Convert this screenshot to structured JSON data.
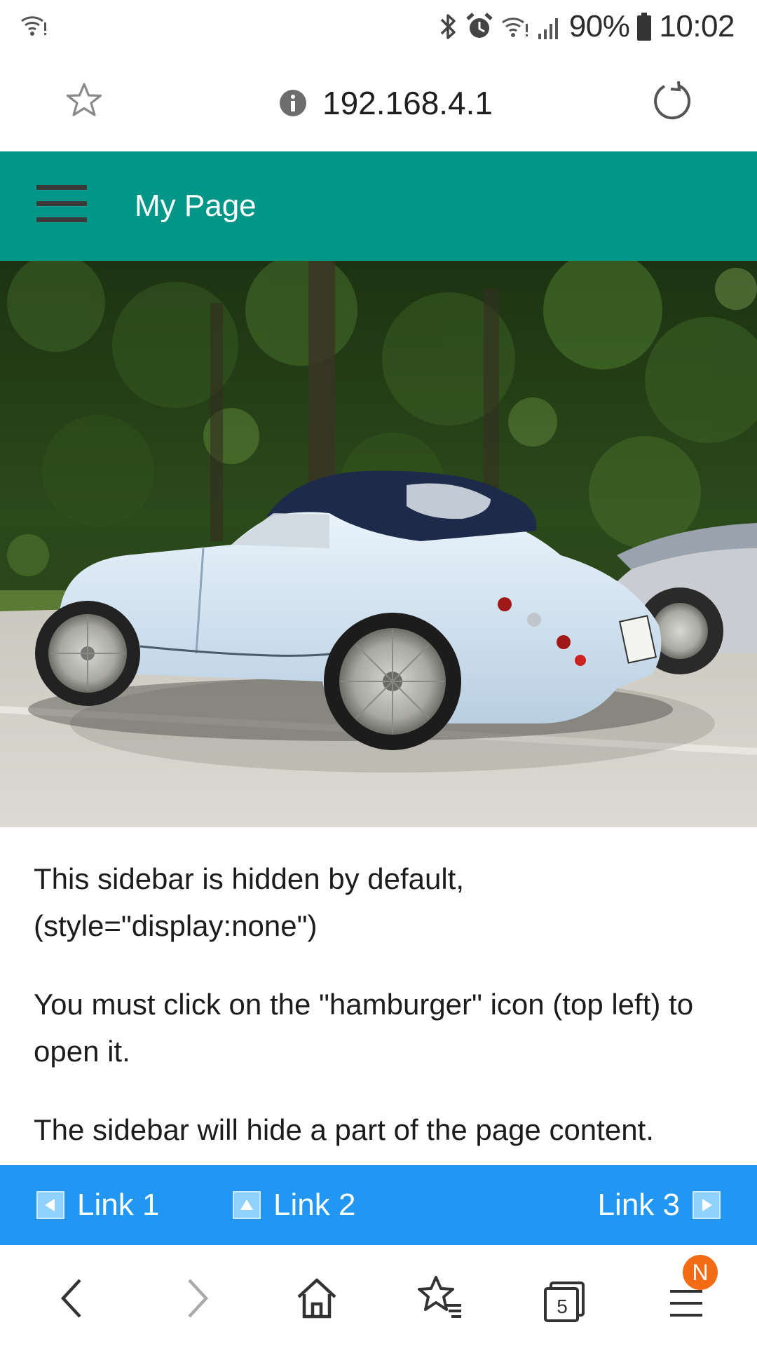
{
  "status_bar": {
    "battery_percent": "90%",
    "time": "10:02"
  },
  "browser": {
    "url": "192.168.4.1",
    "tabs_count": "5",
    "menu_badge": "N"
  },
  "app_bar": {
    "title": "My Page"
  },
  "content": {
    "paragraphs": [
      "This sidebar is hidden by default, (style=\"display:none\")",
      "You must click on the \"hamburger\" icon (top left) to open it.",
      "The sidebar will hide a part of the page content."
    ]
  },
  "link_bar": {
    "links": [
      {
        "label": "Link 1",
        "arrow": "left"
      },
      {
        "label": "Link 2",
        "arrow": "up"
      },
      {
        "label": "Link 3",
        "arrow": "right"
      }
    ]
  },
  "colors": {
    "app_bar": "#009688",
    "link_bar": "#2196f3",
    "menu_badge": "#f36c15"
  }
}
